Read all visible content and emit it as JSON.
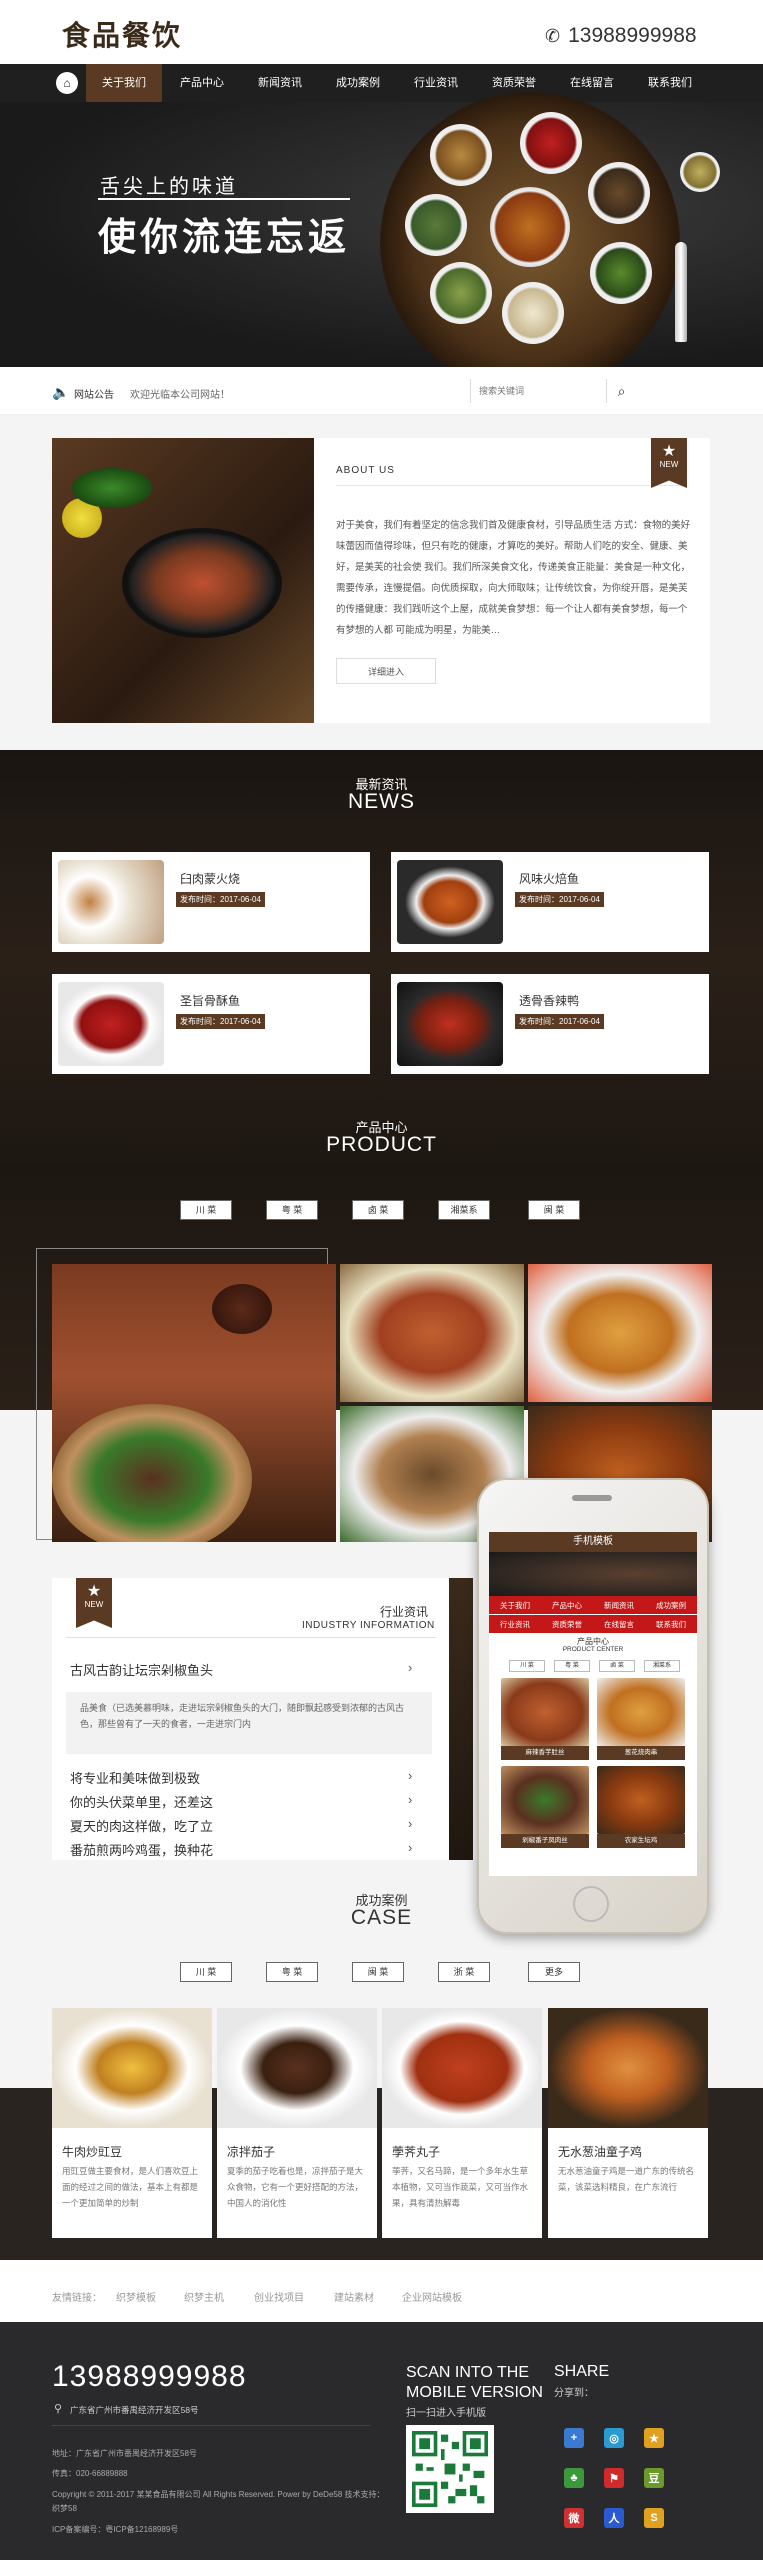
{
  "header": {
    "logo": "食品餐饮",
    "phone": "13988999988"
  },
  "nav": {
    "items": [
      "关于我们",
      "产品中心",
      "新闻资讯",
      "成功案例",
      "行业资讯",
      "资质荣誉",
      "在线留言",
      "联系我们"
    ]
  },
  "banner": {
    "line1": "舌尖上的味道",
    "line2": "使你流连忘返"
  },
  "notice": {
    "label": "网站公告",
    "text": "欢迎光临本公司网站！",
    "search_placeholder": "搜索关键词"
  },
  "about": {
    "title": "ABOUT US",
    "badge": "NEW",
    "text": "对于美食，我们有着坚定的信念我们首及健康食材，引导品质生活 方式：食物的美好味蕾因而值得珍味，但只有吃的健康，才算吃的美好。帮助人们吃的安全、健康、美好，是美芙的社会使 我们。我们所深美食文化，传递美食正能量：美食是一种文化，需要传承，连慢提倡。向优质探取，向大师取味；让传统饮食，为你绽开唇，是美芙的传播健康：我们践听这个上屋，成就美食梦想：每一个让人都有美食梦想，每一个有梦想的人都 可能成为明星，为能美…",
    "more": "详细进入"
  },
  "news": {
    "cn": "最新资讯",
    "en": "NEWS",
    "items": [
      {
        "title": "臼肉蒙火烧",
        "date": "发布时间：2017-06-04"
      },
      {
        "title": "风味火焙鱼",
        "date": "发布时间：2017-06-04"
      },
      {
        "title": "圣旨骨酥鱼",
        "date": "发布时间：2017-06-04"
      },
      {
        "title": "透骨香辣鸭",
        "date": "发布时间：2017-06-04"
      }
    ]
  },
  "product": {
    "cn": "产品中心",
    "en": "PRODUCT",
    "tabs": [
      "川 菜",
      "粤 菜",
      "卤 菜",
      "湘菜系",
      "闽 菜"
    ]
  },
  "industry": {
    "badge": "NEW",
    "cn": "行业资讯",
    "en": "INDUSTRY INFORMATION",
    "first": "古风古韵让坛宗剁椒鱼头",
    "quote": "品美食（已选美慕明味，走进坛宗剁椒鱼头的大门，随即飘起感受到浓郁的古风古色，那些曾有了一天的食者，一走进宗门内",
    "items": [
      "将专业和美味做到极致",
      "你的头伏菜单里，还差这",
      "夏天的肉这样做，吃了立",
      "番茄煎两吟鸡蛋，换种花"
    ]
  },
  "mobile": {
    "title": "手机模板",
    "nav1": [
      "关于我们",
      "产品中心",
      "新闻资讯",
      "成功案例"
    ],
    "nav2": [
      "行业资讯",
      "资质荣誉",
      "在线留言",
      "联系我们"
    ],
    "sec_cn": "产品中心",
    "sec_en": "PRODUCT CENTER",
    "tabs": [
      "川 菜",
      "粤 菜",
      "卤 菜",
      "湘菜系"
    ],
    "captions": [
      "麻辣香芋肚丝",
      "葱花烧肉串",
      "剁椒番子凤肉丝",
      "农家生坛鸡"
    ]
  },
  "cases": {
    "cn": "成功案例",
    "en": "CASE",
    "tabs": [
      "川 菜",
      "粤 菜",
      "闽 菜",
      "浙 菜",
      "更多"
    ],
    "items": [
      {
        "title": "牛肉炒豇豆",
        "desc": "用豇豆做主要食材，是人们喜欢豆上面的经过之间的做法，基本上有都是一个更加简单的炒制"
      },
      {
        "title": "凉拌茄子",
        "desc": "夏季的茄子吃着也是，凉拌茄子是大众食物，它有一个更好搭配的方法，中国人的消化性"
      },
      {
        "title": "荸荠丸子",
        "desc": "荸荠，又名马蹄，是一个多年水生草本植物，又可当作蔬菜，又可当作水果，具有清热解毒"
      },
      {
        "title": "无水葱油童子鸡",
        "desc": "无水葱油童子鸡是一道广东的传统名菜，该菜选料精良，在广东流行"
      }
    ]
  },
  "links": {
    "label": "友情链接：",
    "items": [
      "织梦模板",
      "织梦主机",
      "创业找项目",
      "建站素材",
      "企业网站模板"
    ]
  },
  "footer": {
    "phone": "13988999988",
    "address": "广东省广州市番禺经济开发区58号",
    "addr2": "地址：广东省广州市番禺经济开发区58号",
    "fax": "传真：020-66889888",
    "copyright": "Copyright © 2011-2017 某某食品有限公司 All Rights Reserved. Power by DeDe58 技术支持：织梦58",
    "icp": "ICP备案编号：粤ICP备12168989号",
    "scan1": "SCAN INTO THE",
    "scan2": "MOBILE VERSION",
    "scan3": "扫一扫进入手机版",
    "share": "SHARE",
    "share_sub": "分享到："
  },
  "colors": {
    "brand": "#5a3a22",
    "dark": "#1f1f1f",
    "red": "#c41818",
    "footer": "#2a2a2c"
  }
}
